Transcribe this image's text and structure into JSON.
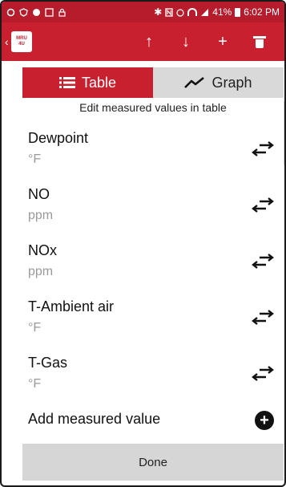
{
  "status_bar": {
    "left_icons": [
      "sync-icon",
      "shield-icon",
      "circle-icon",
      "image-icon",
      "lock-icon"
    ],
    "bluetooth": "✱",
    "battery_percent": "41%",
    "time": "6:02 PM"
  },
  "app_bar": {
    "logo_line1": "MRU",
    "logo_line2": "4U",
    "actions": [
      "arrow-up-icon",
      "arrow-down-icon",
      "plus-icon",
      "trash-icon"
    ]
  },
  "tabs": [
    {
      "label": "Table",
      "icon": "list-icon",
      "active": true
    },
    {
      "label": "Graph",
      "icon": "trend-icon",
      "active": false
    }
  ],
  "subtitle": "Edit measured values in table",
  "measured_values": [
    {
      "name": "Dewpoint",
      "unit": "°F"
    },
    {
      "name": "NO",
      "unit": "ppm"
    },
    {
      "name": "NOx",
      "unit": "ppm"
    },
    {
      "name": "T-Ambient air",
      "unit": "°F"
    },
    {
      "name": "T-Gas",
      "unit": "°F"
    }
  ],
  "add_label": "Add measured value",
  "done_label": "Done",
  "colors": {
    "primary": "#c8202f",
    "statusbar": "#b71c2c",
    "button_gray": "#d6d6d6"
  }
}
